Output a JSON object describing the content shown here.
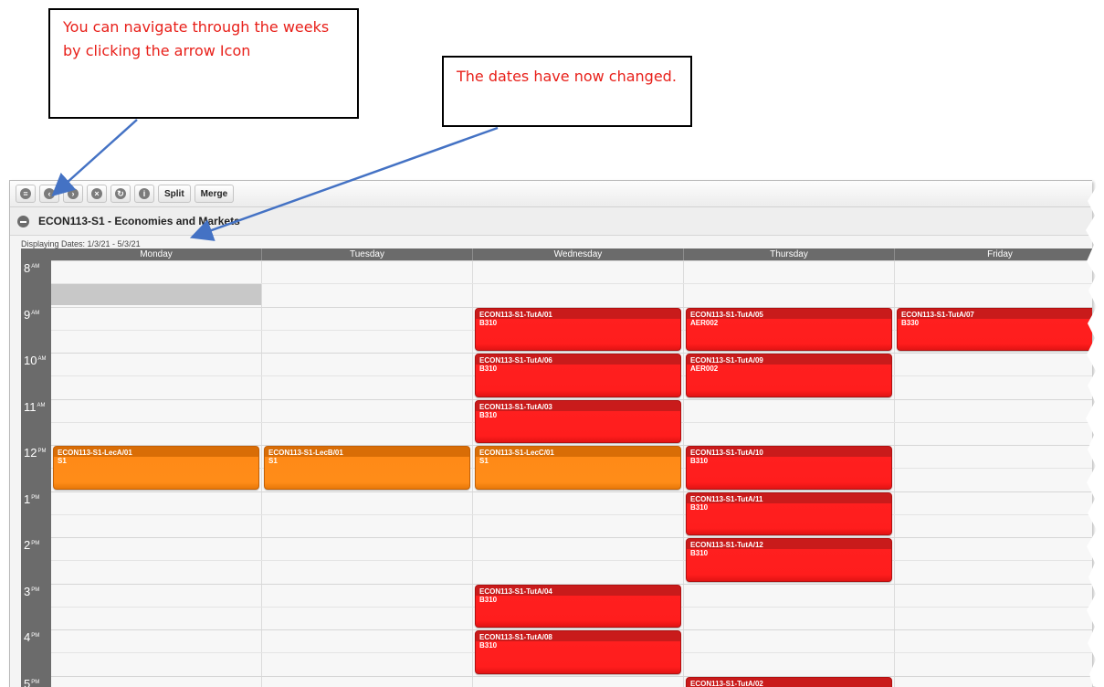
{
  "annotations": {
    "callout1": "You can navigate through the weeks by clicking the arrow Icon",
    "callout2": "The dates have now changed."
  },
  "toolbar": {
    "icons": [
      "menu-icon",
      "prev-week-icon",
      "next-week-icon",
      "close-icon",
      "refresh-icon",
      "info-icon"
    ],
    "split_label": "Split",
    "merge_label": "Merge"
  },
  "header": {
    "course_title": "ECON113-S1 - Economies and Markets",
    "display_dates": "Displaying Dates: 1/3/21 - 5/3/21"
  },
  "days": [
    "Monday",
    "Tuesday",
    "Wednesday",
    "Thursday",
    "Friday"
  ],
  "hours": [
    {
      "h": "8",
      "ap": "AM"
    },
    {
      "h": "9",
      "ap": "AM"
    },
    {
      "h": "10",
      "ap": "AM"
    },
    {
      "h": "11",
      "ap": "AM"
    },
    {
      "h": "12",
      "ap": "PM"
    },
    {
      "h": "1",
      "ap": "PM"
    },
    {
      "h": "2",
      "ap": "PM"
    },
    {
      "h": "3",
      "ap": "PM"
    },
    {
      "h": "4",
      "ap": "PM"
    },
    {
      "h": "5",
      "ap": "PM"
    }
  ],
  "events": [
    {
      "title": "ECON113-S1-TutA/01",
      "room": "B310",
      "day": 2,
      "start": 9,
      "color": "red"
    },
    {
      "title": "ECON113-S1-TutA/06",
      "room": "B310",
      "day": 2,
      "start": 10,
      "color": "red"
    },
    {
      "title": "ECON113-S1-TutA/03",
      "room": "B310",
      "day": 2,
      "start": 11,
      "color": "red"
    },
    {
      "title": "ECON113-S1-LecC/01",
      "room": "S1",
      "day": 2,
      "start": 12,
      "color": "orange"
    },
    {
      "title": "ECON113-S1-TutA/04",
      "room": "B310",
      "day": 2,
      "start": 15,
      "color": "red"
    },
    {
      "title": "ECON113-S1-TutA/08",
      "room": "B310",
      "day": 2,
      "start": 16,
      "color": "red"
    },
    {
      "title": "ECON113-S1-TutA/05",
      "room": "AER002",
      "day": 3,
      "start": 9,
      "color": "red"
    },
    {
      "title": "ECON113-S1-TutA/09",
      "room": "AER002",
      "day": 3,
      "start": 10,
      "color": "red"
    },
    {
      "title": "ECON113-S1-TutA/10",
      "room": "B310",
      "day": 3,
      "start": 12,
      "color": "red"
    },
    {
      "title": "ECON113-S1-TutA/11",
      "room": "B310",
      "day": 3,
      "start": 13,
      "color": "red"
    },
    {
      "title": "ECON113-S1-TutA/12",
      "room": "B310",
      "day": 3,
      "start": 14,
      "color": "red"
    },
    {
      "title": "ECON113-S1-TutA/02",
      "room": "",
      "day": 3,
      "start": 17,
      "color": "red"
    },
    {
      "title": "ECON113-S1-TutA/07",
      "room": "B330",
      "day": 4,
      "start": 9,
      "color": "red"
    },
    {
      "title": "ECON113-S1-LecA/01",
      "room": "S1",
      "day": 0,
      "start": 12,
      "color": "orange"
    },
    {
      "title": "ECON113-S1-LecB/01",
      "room": "S1",
      "day": 1,
      "start": 12,
      "color": "orange"
    }
  ]
}
